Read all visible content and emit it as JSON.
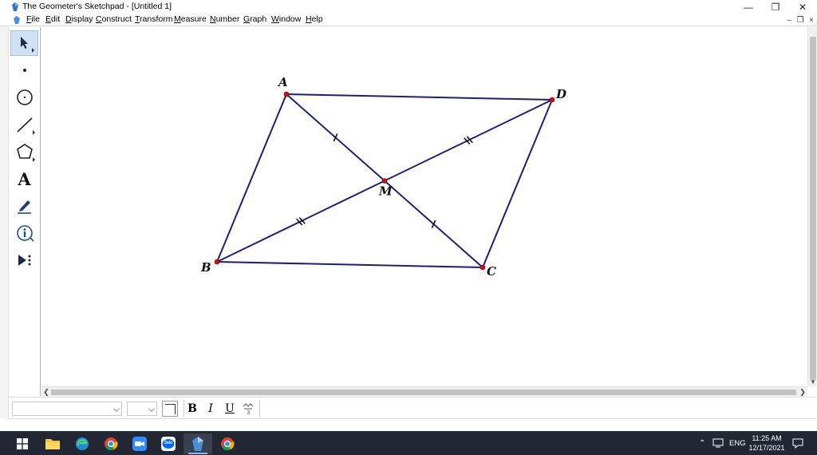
{
  "window": {
    "title": "The Geometer's Sketchpad - [Untitled 1]",
    "buttons": {
      "minimize": "—",
      "restore": "❐",
      "close": "✕"
    },
    "mdi_buttons": {
      "minimize": "–",
      "restore": "❐",
      "close": "×"
    }
  },
  "menu": [
    {
      "key": "file",
      "hot": "F",
      "rest": "ile"
    },
    {
      "key": "edit",
      "hot": "E",
      "rest": "dit"
    },
    {
      "key": "display",
      "hot": "D",
      "rest": "isplay"
    },
    {
      "key": "construct",
      "hot": "C",
      "rest": "onstruct"
    },
    {
      "key": "transform",
      "hot": "T",
      "rest": "ransform"
    },
    {
      "key": "measure",
      "hot": "M",
      "rest": "easure"
    },
    {
      "key": "number",
      "hot": "N",
      "rest": "umber"
    },
    {
      "key": "graph",
      "hot": "G",
      "rest": "raph"
    },
    {
      "key": "window",
      "hot": "W",
      "rest": "indow"
    },
    {
      "key": "help",
      "hot": "H",
      "rest": "elp"
    }
  ],
  "toolbox": {
    "tools": [
      {
        "name": "arrow-select-tool",
        "icon": "arrow-cursor-icon",
        "selected": true
      },
      {
        "name": "point-tool",
        "icon": "point-icon",
        "selected": false
      },
      {
        "name": "compass-tool",
        "icon": "circle-icon",
        "selected": false
      },
      {
        "name": "straightedge-tool",
        "icon": "segment-icon",
        "selected": false
      },
      {
        "name": "polygon-tool",
        "icon": "polygon-icon",
        "selected": false
      },
      {
        "name": "text-tool",
        "icon": "text-a-icon",
        "selected": false
      },
      {
        "name": "marker-tool",
        "icon": "marker-pen-icon",
        "selected": false
      },
      {
        "name": "information-tool",
        "icon": "info-icon",
        "selected": false
      },
      {
        "name": "custom-tools",
        "icon": "custom-tools-icon",
        "selected": false
      }
    ],
    "text_tool_glyph": "A"
  },
  "sketch": {
    "color_line": "#1b1f7a",
    "color_point": "#cc1111",
    "points": [
      {
        "label": "A"
      },
      {
        "label": "B"
      },
      {
        "label": "C"
      },
      {
        "label": "D"
      },
      {
        "label": "M"
      }
    ],
    "segments": [
      "AD",
      "DC",
      "CB",
      "BA",
      "AC",
      "BD"
    ],
    "tick_marks": {
      "AM": 1,
      "MC": 1,
      "BM": 2,
      "MD": 2
    }
  },
  "formatbar": {
    "bold": "B",
    "italic": "I",
    "underline": "U",
    "math_format_icon": "math-format-icon"
  },
  "taskbar": {
    "apps": [
      "windows-start-icon",
      "file-explorer-icon",
      "edge-icon",
      "chrome-icon",
      "zoom-icon",
      "zalo-icon",
      "sketchpad-icon",
      "chrome-icon"
    ],
    "zalo_label": "Zalo",
    "tray_language": "ENG",
    "time": "11:25 AM",
    "date": "12/17/2021"
  }
}
